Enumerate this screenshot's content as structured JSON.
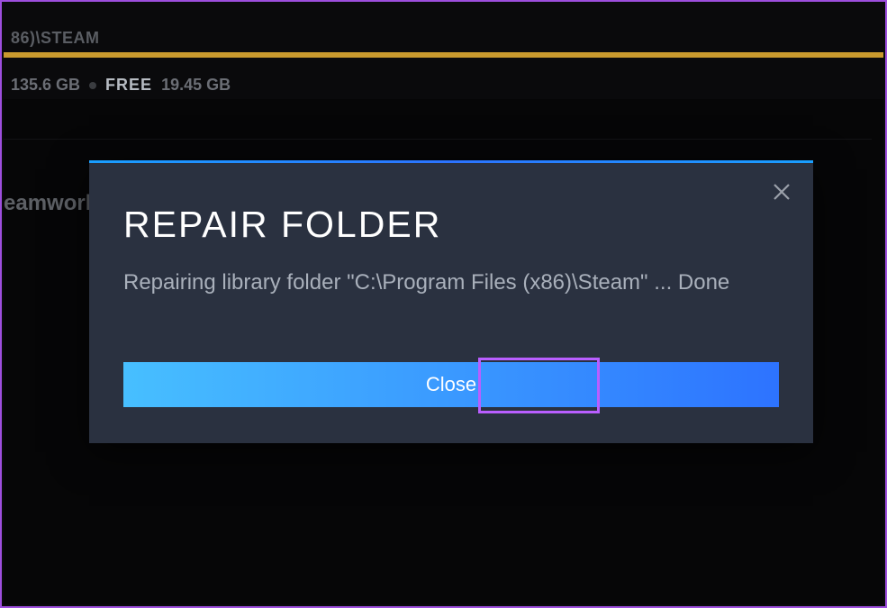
{
  "background": {
    "path_fragment": "86)\\STEAM",
    "used_space": "135.6 GB",
    "free_label": "FREE",
    "free_space": "19.45 GB",
    "partial_text": "eamwork"
  },
  "dialog": {
    "title": "REPAIR FOLDER",
    "message": "Repairing library folder \"C:\\Program Files (x86)\\Steam\" ... Done",
    "close_label": "Close"
  }
}
